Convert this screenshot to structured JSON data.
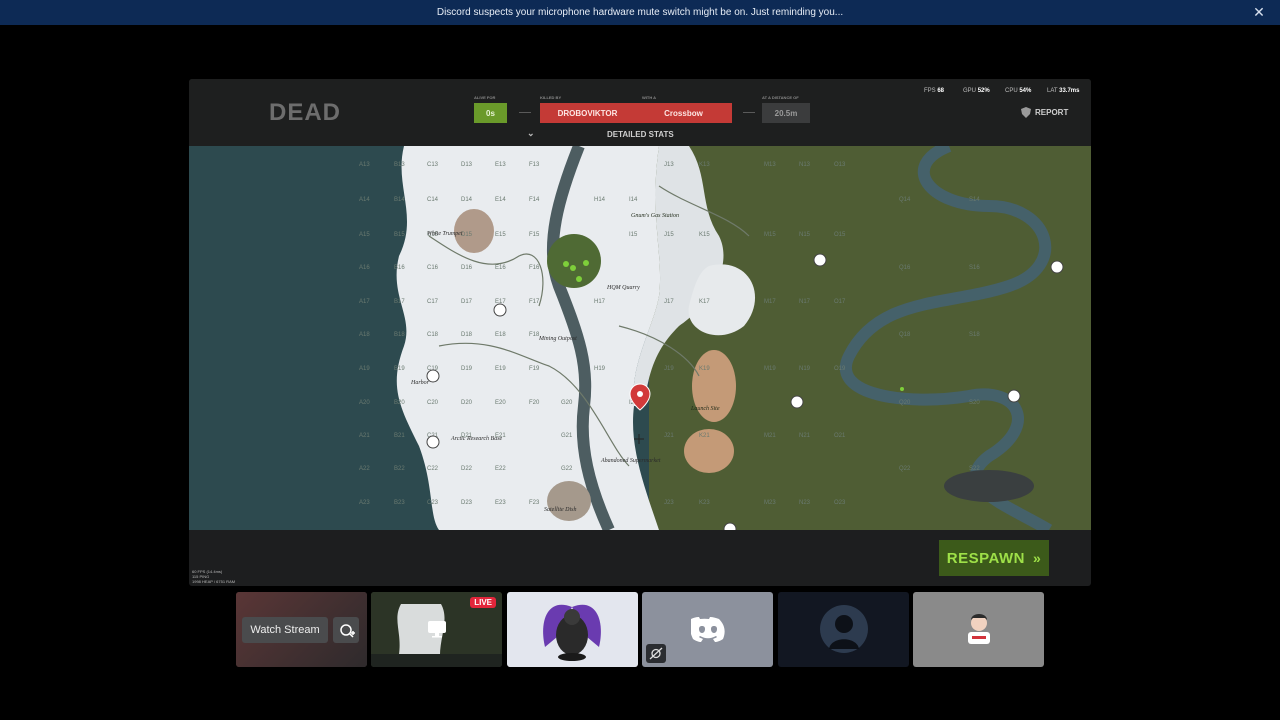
{
  "notice": {
    "text": "Discord suspects your microphone hardware mute switch might be on. Just reminding you..."
  },
  "hud": {
    "dead_label": "DEAD",
    "alive_for_label": "ALIVE FOR",
    "alive_for_value": "0s",
    "killed_by_label": "KILLED BY",
    "killer_name": "DROBOVIKTOR",
    "with_a_label": "WITH A",
    "weapon": "Crossbow",
    "distance_label": "AT A DISTANCE OF",
    "distance_value": "20.5m",
    "detailed_stats_label": "DETAILED STATS",
    "report_label": "REPORT",
    "perf": {
      "fps_label": "FPS",
      "fps_value": "68",
      "gpu_label": "GPU",
      "gpu_value": "52%",
      "cpu_label": "CPU",
      "cpu_value": "54%",
      "lat_label": "LAT",
      "lat_value": "33.7ms"
    },
    "debug_lines": [
      "60 FPS (14.4ms)",
      "115 PING",
      "1998 HEAP / 6751 RAM"
    ],
    "respawn_label": "RESPAWN"
  },
  "map": {
    "labels": [
      "White Trumpet",
      "Gnum's Gas Station",
      "HQM Quarry",
      "Mining Outpost",
      "Harbor",
      "Arctic Research Base",
      "Launch Site",
      "Abandoned Supermarket",
      "Satellite Dish"
    ],
    "grid_cells": [
      "A13",
      "B13",
      "C13",
      "D13",
      "E13",
      "F13",
      "A14",
      "B14",
      "C14",
      "D14",
      "E14",
      "F14",
      "H14",
      "I14",
      "A15",
      "B15",
      "C15",
      "D15",
      "E15",
      "F15",
      "I15",
      "A16",
      "B16",
      "C16",
      "D16",
      "E16",
      "F16",
      "A17",
      "B17",
      "C17",
      "D17",
      "E17",
      "F17",
      "H17",
      "A18",
      "B18",
      "C18",
      "D18",
      "E18",
      "F18",
      "A19",
      "B19",
      "C19",
      "D19",
      "E19",
      "F19",
      "H19",
      "A20",
      "B20",
      "C20",
      "D20",
      "E20",
      "F20",
      "G20",
      "I20",
      "A21",
      "B21",
      "C21",
      "D21",
      "E21",
      "G21",
      "A22",
      "B22",
      "C22",
      "D22",
      "E22",
      "G22",
      "A23",
      "B23",
      "C23",
      "D23",
      "E23",
      "F23",
      "J13",
      "K13",
      "M13",
      "N13",
      "O13",
      "J15",
      "K15",
      "M15",
      "N15",
      "O15",
      "J17",
      "K17",
      "M17",
      "N17",
      "O17",
      "J19",
      "K19",
      "M19",
      "N19",
      "O19",
      "J21",
      "K21",
      "M21",
      "N21",
      "O21",
      "J23",
      "K23",
      "M23",
      "N23",
      "O23",
      "Q14",
      "Q16",
      "Q18",
      "Q20",
      "Q22",
      "S14",
      "S16",
      "S18",
      "S20",
      "S22"
    ]
  },
  "stream": {
    "watch_label": "Watch Stream",
    "live_badge": "LIVE"
  },
  "colors": {
    "notice_bg": "#0d2a55",
    "killer_bg": "#c43a36",
    "alive_bg": "#6a9a2a",
    "respawn_bg": "#3c5a1a",
    "respawn_text": "#9ee048",
    "live_badge": "#e2263b",
    "discord_blurple": "#5865f2"
  }
}
